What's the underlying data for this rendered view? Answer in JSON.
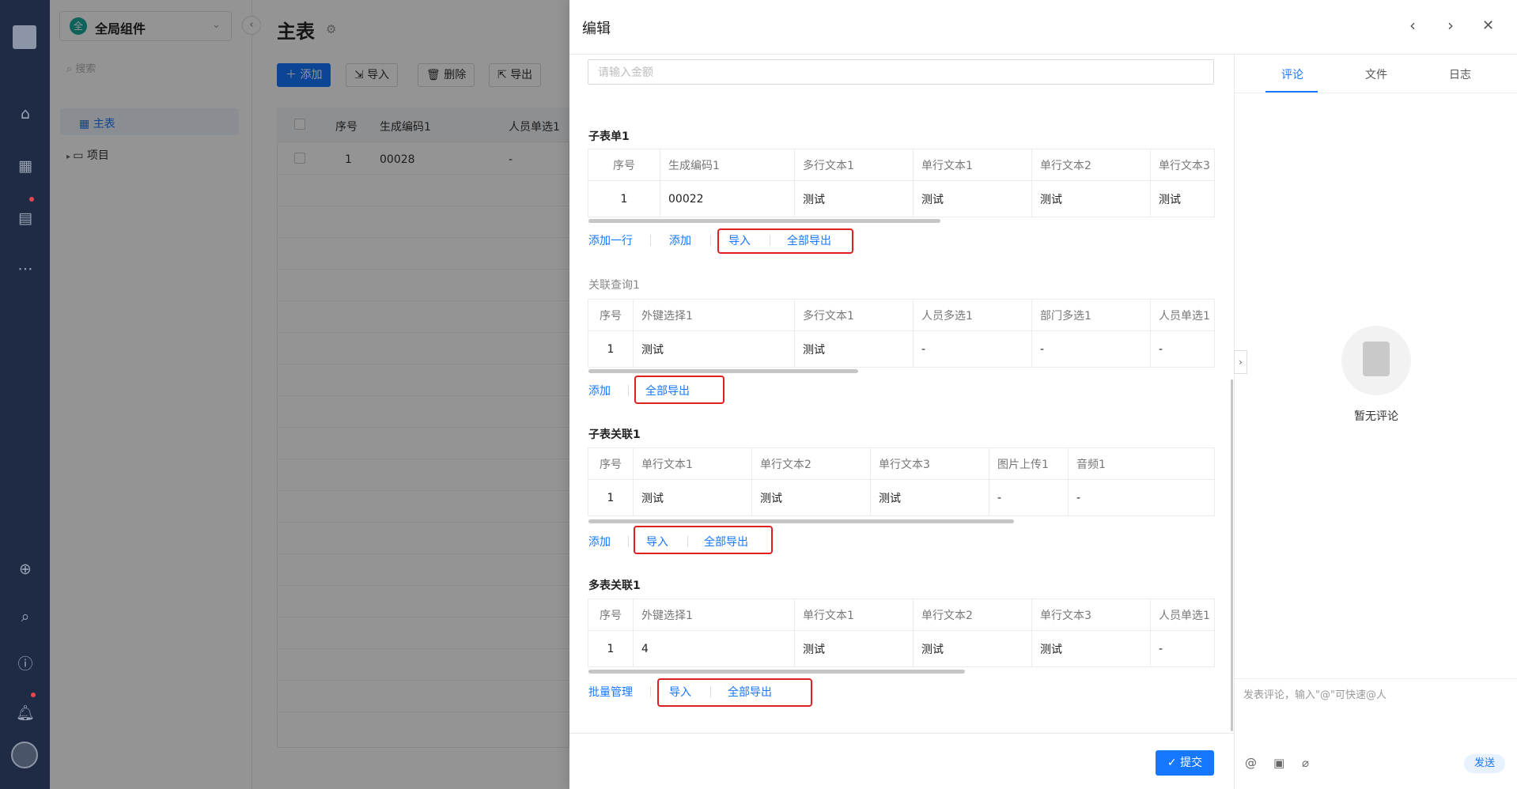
{
  "sidebar": {
    "workspace": {
      "logo_char": "全",
      "name": "全局组件"
    },
    "search_placeholder": "搜索",
    "nav": [
      {
        "label": "主表"
      },
      {
        "label": "项目"
      }
    ]
  },
  "main": {
    "title": "主表",
    "toolbar": {
      "add": "添加",
      "import": "导入",
      "delete": "删除",
      "export": "导出"
    },
    "columns": [
      "序号",
      "生成编码1",
      "人员单选1"
    ],
    "rows": [
      {
        "index": "1",
        "code": "00028",
        "person": "-"
      }
    ]
  },
  "drawer": {
    "title": "编辑",
    "amount_placeholder": "请输入金额",
    "sections": [
      {
        "title": "子表单1",
        "columns": [
          "序号",
          "生成编码1",
          "多行文本1",
          "单行文本1",
          "单行文本2",
          "单行文本3"
        ],
        "rows": [
          [
            "1",
            "00022",
            "测试",
            "测试",
            "测试",
            "测试"
          ]
        ],
        "actions": [
          "添加一行",
          "添加",
          "导入",
          "全部导出"
        ]
      },
      {
        "title": "关联查询1",
        "columns": [
          "序号",
          "外键选择1",
          "多行文本1",
          "人员多选1",
          "部门多选1",
          "人员单选1"
        ],
        "rows": [
          [
            "1",
            "测试",
            "测试",
            "-",
            "-",
            "-"
          ]
        ],
        "actions": [
          "添加",
          "全部导出"
        ]
      },
      {
        "title": "子表关联1",
        "columns": [
          "序号",
          "单行文本1",
          "单行文本2",
          "单行文本3",
          "图片上传1",
          "音频1"
        ],
        "rows": [
          [
            "1",
            "测试",
            "测试",
            "测试",
            "-",
            "-"
          ]
        ],
        "actions": [
          "添加",
          "导入",
          "全部导出"
        ]
      },
      {
        "title": "多表关联1",
        "columns": [
          "序号",
          "外键选择1",
          "单行文本1",
          "单行文本2",
          "单行文本3",
          "人员单选1"
        ],
        "rows": [
          [
            "1",
            "4",
            "测试",
            "测试",
            "测试",
            "-"
          ]
        ],
        "actions": [
          "批量管理",
          "导入",
          "全部导出"
        ]
      }
    ],
    "submit": "提交"
  },
  "comments": {
    "tabs": [
      "评论",
      "文件",
      "日志"
    ],
    "active_tab": "评论",
    "empty_text": "暂无评论",
    "input_placeholder": "发表评论，输入\"@\"可快速@人",
    "send": "发送"
  },
  "icons": [
    "home-icon",
    "apps-icon",
    "document-icon",
    "more-icon",
    "add-circle-icon",
    "search-icon",
    "help-icon",
    "bell-icon",
    "gear-icon",
    "chevron-left-icon",
    "chevron-right-icon",
    "close-icon",
    "at-icon",
    "image-icon",
    "attachment-icon"
  ],
  "colors": {
    "primary": "#1677ff",
    "rail": "#1f2b45",
    "highlight": "#e02020",
    "logo": "#18a99c"
  }
}
